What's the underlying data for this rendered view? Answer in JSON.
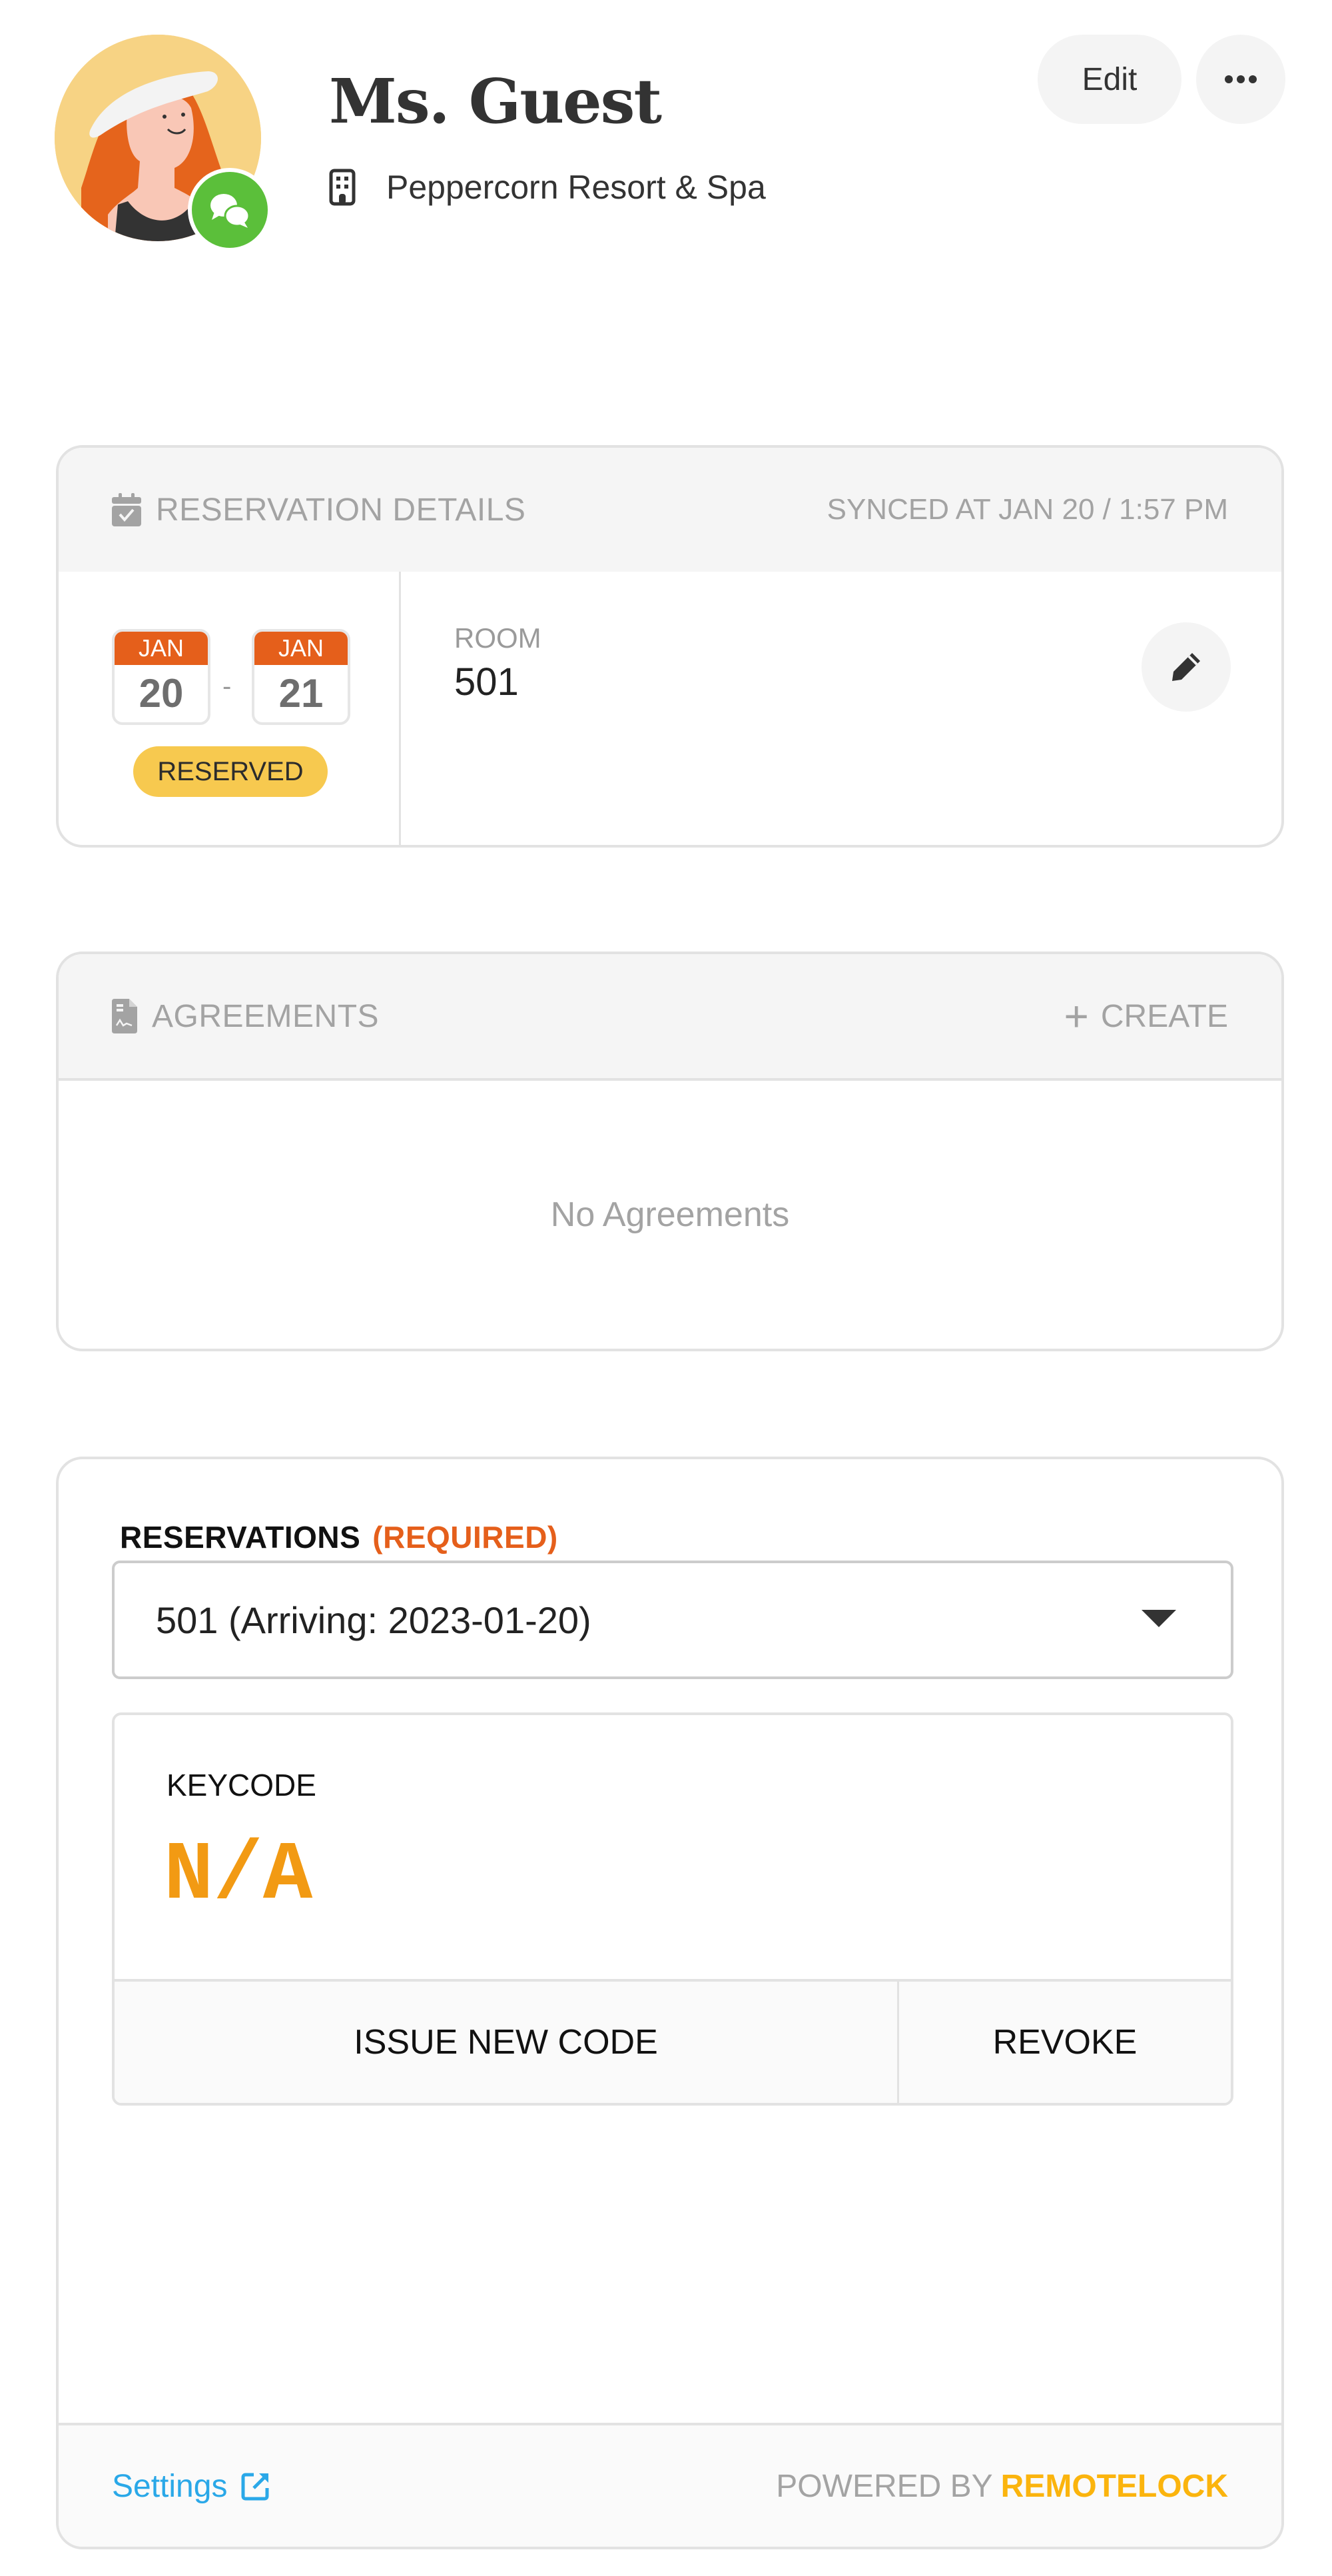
{
  "header": {
    "guest_name": "Ms. Guest",
    "property_name": "Peppercorn Resort & Spa",
    "edit_label": "Edit",
    "more_icon": "more-horizontal-icon",
    "avatar_icon": "guest-avatar",
    "badge_icon": "chat-bubbles-icon",
    "property_icon": "building-icon"
  },
  "reservation_details": {
    "title": "RESERVATION DETAILS",
    "icon": "calendar-check-icon",
    "synced": "SYNCED AT JAN 20 / 1:57 PM",
    "check_in": {
      "month": "JAN",
      "day": "20"
    },
    "range_separator": "-",
    "check_out": {
      "month": "JAN",
      "day": "21"
    },
    "status": "RESERVED",
    "room_label": "ROOM",
    "room_value": "501",
    "edit_icon": "pencil-icon"
  },
  "agreements": {
    "title": "AGREEMENTS",
    "icon": "signed-document-icon",
    "create_label": "CREATE",
    "create_icon": "+",
    "empty_text": "No Agreements"
  },
  "keycode": {
    "field_label": "RESERVATIONS",
    "required_label": "(REQUIRED)",
    "selected_reservation": "501 (Arriving: 2023-01-20)",
    "keycode_label": "KEYCODE",
    "keycode_value": "N/A",
    "issue_label": "ISSUE NEW CODE",
    "revoke_label": "REVOKE"
  },
  "footer": {
    "settings_label": "Settings",
    "settings_icon": "external-link-icon",
    "powered_by": "POWERED BY",
    "brand": "REMOTELOCK"
  },
  "colors": {
    "accent_orange": "#e55f1b",
    "status_yellow": "#f7c94f",
    "keycode_orange": "#f29a13",
    "link_blue": "#2aa8e8",
    "brand_yellow": "#fbb40d",
    "badge_green": "#5bbf3a"
  }
}
